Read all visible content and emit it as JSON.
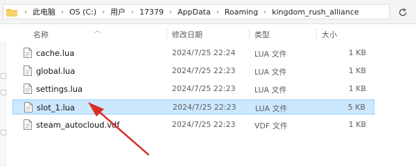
{
  "address": {
    "crumbs": [
      "此电脑",
      "OS (C:)",
      "用户",
      "17379",
      "AppData",
      "Roaming",
      "kingdom_rush_alliance"
    ],
    "separator": "›"
  },
  "columns": {
    "name": "名称",
    "modified": "修改日期",
    "type": "类型",
    "size": "大小"
  },
  "files": [
    {
      "name": "cache.lua",
      "modified": "2024/7/25 22:24",
      "type": "LUA 文件",
      "size": "1 KB",
      "selected": false
    },
    {
      "name": "global.lua",
      "modified": "2024/7/25 22:23",
      "type": "LUA 文件",
      "size": "1 KB",
      "selected": false
    },
    {
      "name": "settings.lua",
      "modified": "2024/7/25 22:23",
      "type": "LUA 文件",
      "size": "1 KB",
      "selected": false
    },
    {
      "name": "slot_1.lua",
      "modified": "2024/7/25 22:23",
      "type": "LUA 文件",
      "size": "5 KB",
      "selected": true
    },
    {
      "name": "steam_autocloud.vdf",
      "modified": "2024/7/25 22:23",
      "type": "VDF 文件",
      "size": "1 KB",
      "selected": false
    }
  ],
  "colors": {
    "selection_bg": "#cce8ff",
    "selection_border": "#99d1ff",
    "annotation_arrow": "#d9302a",
    "folder": "#f2c14e"
  },
  "icons": {
    "refresh": "refresh-icon",
    "folder": "folder-icon",
    "file": "document-file-icon"
  }
}
